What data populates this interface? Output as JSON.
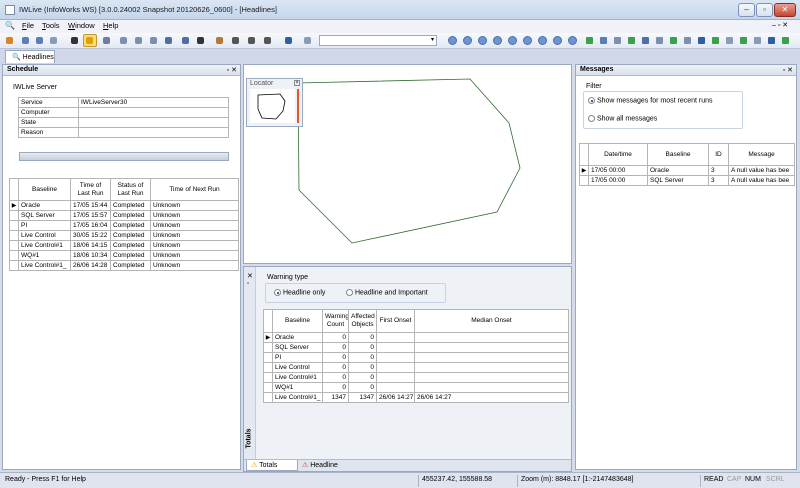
{
  "window": {
    "title": "IWLive (InfoWorks WS) [3.0.0.24002 Snapshot 20120626_0600] - [Headlines]"
  },
  "menu": {
    "items": [
      {
        "u": "F",
        "rest": "ile"
      },
      {
        "u": "T",
        "rest": "ools"
      },
      {
        "u": "W",
        "rest": "indow"
      },
      {
        "u": "H",
        "rest": "elp"
      }
    ]
  },
  "doc_tab": {
    "label": "Headlines"
  },
  "schedule": {
    "title": "Schedule",
    "server_label": "IWLive Server",
    "props": [
      {
        "key": "Service",
        "value": "IWLiveServer30"
      },
      {
        "key": "Computer",
        "value": ""
      },
      {
        "key": "State",
        "value": ""
      },
      {
        "key": "Reason",
        "value": ""
      }
    ],
    "columns": [
      "Baseline",
      "Time of Last Run",
      "Status of Last Run",
      "Time of Next Run"
    ],
    "rows": [
      {
        "baseline": "Oracle",
        "last": "17/05 15:44",
        "status": "Completed",
        "next": "Unknown"
      },
      {
        "baseline": "SQL Server",
        "last": "17/05 15:57",
        "status": "Completed",
        "next": "Unknown"
      },
      {
        "baseline": "PI",
        "last": "17/05 16:04",
        "status": "Completed",
        "next": "Unknown"
      },
      {
        "baseline": "Live Control",
        "last": "30/05 15:22",
        "status": "Completed",
        "next": "Unknown"
      },
      {
        "baseline": "Live Control#1",
        "last": "18/06 14:15",
        "status": "Completed",
        "next": "Unknown"
      },
      {
        "baseline": "WQ#1",
        "last": "18/06 10:34",
        "status": "Completed",
        "next": "Unknown"
      },
      {
        "baseline": "Live Control#1_",
        "last": "26/06 14:28",
        "status": "Completed",
        "next": "Unknown"
      }
    ]
  },
  "locator": {
    "title": "Locator"
  },
  "warning": {
    "group_title": "Warning type",
    "options": [
      "Headline only",
      "Headline and Important"
    ],
    "selected": "Headline only",
    "columns": [
      "Baseline",
      "Warning Count",
      "Affected Objects",
      "First Onset",
      "Median Onset"
    ],
    "rows": [
      {
        "baseline": "Oracle",
        "count": "0",
        "affected": "0",
        "first": "",
        "median": ""
      },
      {
        "baseline": "SQL Server",
        "count": "0",
        "affected": "0",
        "first": "",
        "median": ""
      },
      {
        "baseline": "PI",
        "count": "0",
        "affected": "0",
        "first": "",
        "median": ""
      },
      {
        "baseline": "Live Control",
        "count": "0",
        "affected": "0",
        "first": "",
        "median": ""
      },
      {
        "baseline": "Live Control#1",
        "count": "0",
        "affected": "0",
        "first": "",
        "median": ""
      },
      {
        "baseline": "WQ#1",
        "count": "0",
        "affected": "0",
        "first": "",
        "median": ""
      },
      {
        "baseline": "Live Control#1_",
        "count": "1347",
        "affected": "1347",
        "first": "26/06 14:27",
        "median": "26/06 14:27"
      }
    ],
    "side_label": "Totals",
    "bottom_tabs": [
      "Totals",
      "Headline"
    ]
  },
  "messages": {
    "title": "Messages",
    "filter_title": "Filter",
    "options": [
      "Show messages for most recent runs",
      "Show all messages"
    ],
    "selected": "Show messages for most recent runs",
    "columns": [
      "Date/time",
      "Baseline",
      "ID",
      "Message"
    ],
    "rows": [
      {
        "dt": "17/05 00:00",
        "baseline": "Oracle",
        "id": "3",
        "msg": "A null value has bee"
      },
      {
        "dt": "17/05 00:00",
        "baseline": "SQL Server",
        "id": "3",
        "msg": "A null value has bee"
      }
    ]
  },
  "status": {
    "help": "Ready - Press F1 for Help",
    "coords": "455237.42, 155588.58",
    "zoom": "Zoom (m): 8848.17 [1:-2147483648]",
    "read": "READ",
    "cap": "CAP",
    "num": "NUM",
    "scrl": "SCRL"
  },
  "colors": {
    "polygon": "#2f6b2f",
    "accent_red": "#e05a2a"
  }
}
